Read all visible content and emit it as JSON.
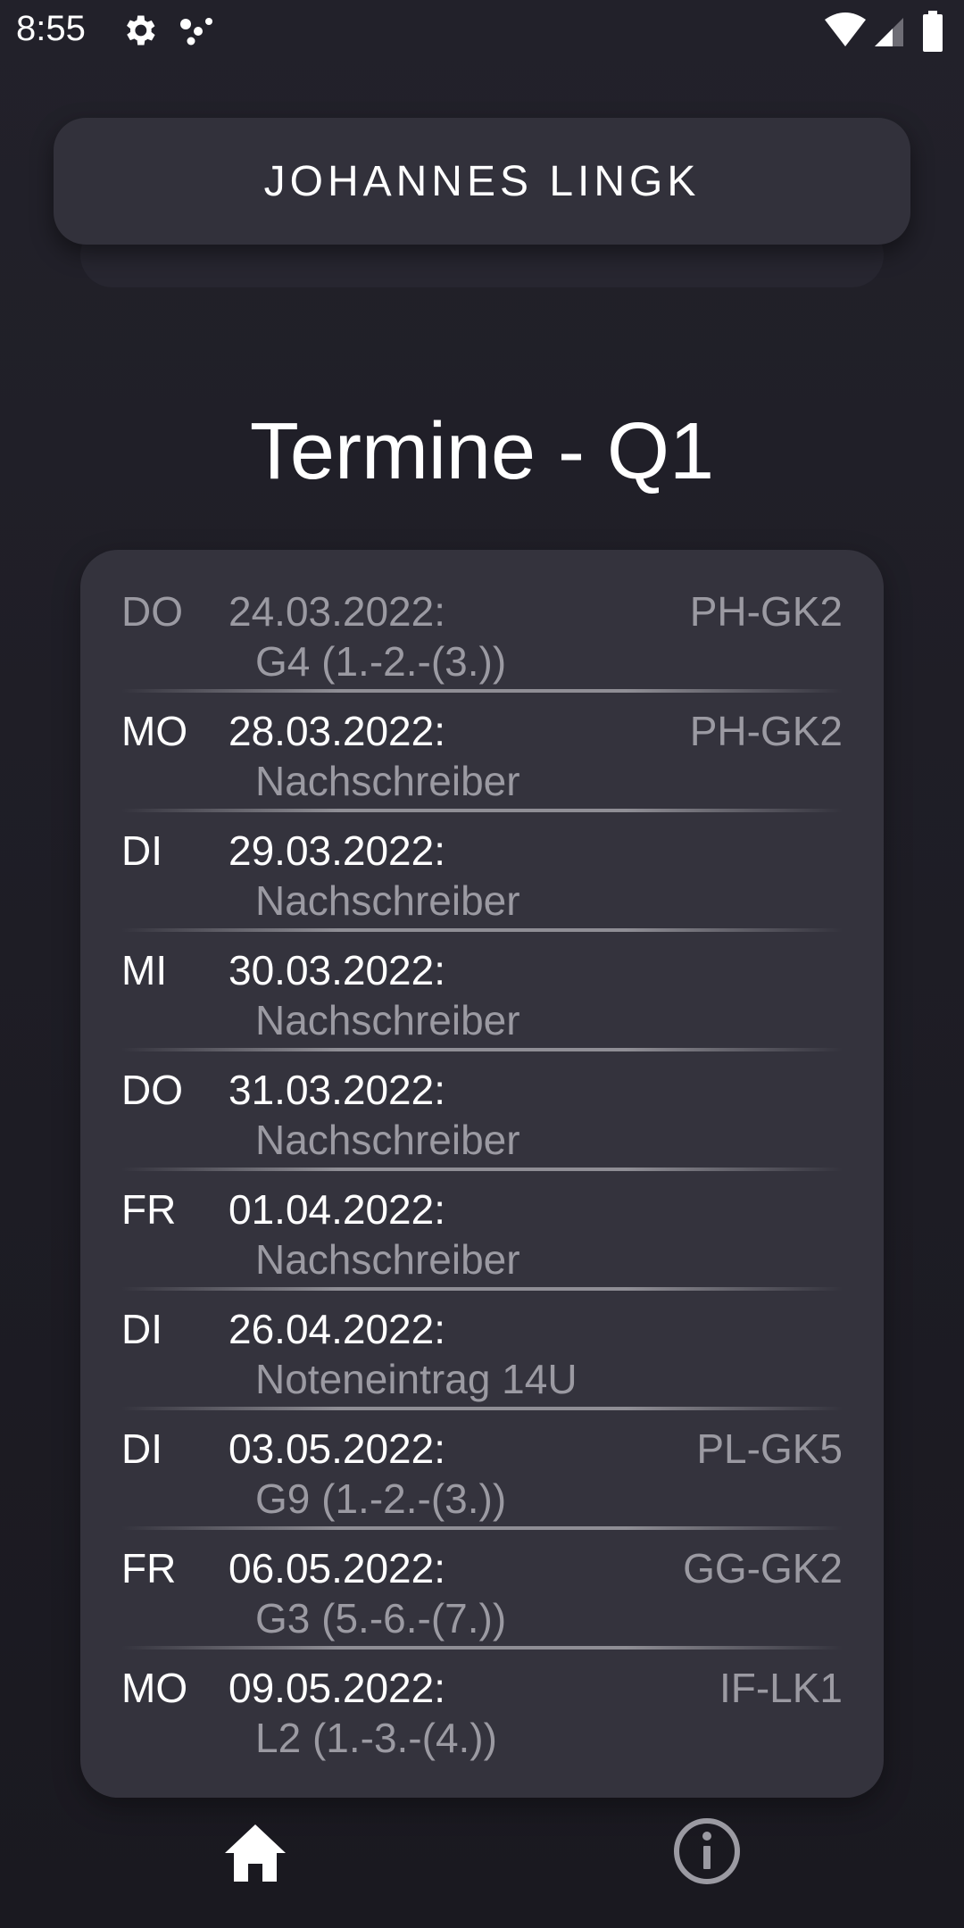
{
  "status_bar": {
    "time": "8:55",
    "icons": [
      "settings-gear-icon",
      "assistant-dots-icon",
      "wifi-icon",
      "cell-signal-icon",
      "battery-icon"
    ]
  },
  "header": {
    "name": "JOHANNES LINGK"
  },
  "page": {
    "title": "Termine - Q1"
  },
  "entries": [
    {
      "day": "DO",
      "date": "24.03.2022:",
      "course": "PH-GK2",
      "desc": "G4 (1.-2.-(3.))"
    },
    {
      "day": "MO",
      "date": "28.03.2022:",
      "course": "PH-GK2",
      "desc": "Nachschreiber"
    },
    {
      "day": "DI",
      "date": "29.03.2022:",
      "course": "",
      "desc": "Nachschreiber"
    },
    {
      "day": "MI",
      "date": "30.03.2022:",
      "course": "",
      "desc": "Nachschreiber"
    },
    {
      "day": "DO",
      "date": "31.03.2022:",
      "course": "",
      "desc": "Nachschreiber"
    },
    {
      "day": "FR",
      "date": "01.04.2022:",
      "course": "",
      "desc": "Nachschreiber"
    },
    {
      "day": "DI",
      "date": "26.04.2022:",
      "course": "",
      "desc": "Noteneintrag 14U"
    },
    {
      "day": "DI",
      "date": "03.05.2022:",
      "course": "PL-GK5",
      "desc": "G9 (1.-2.-(3.))"
    },
    {
      "day": "FR",
      "date": "06.05.2022:",
      "course": "GG-GK2",
      "desc": "G3 (5.-6.-(7.))"
    },
    {
      "day": "MO",
      "date": "09.05.2022:",
      "course": "IF-LK1",
      "desc": "L2 (1.-3.-(4.))"
    }
  ],
  "bottom_nav": {
    "items": [
      {
        "icon": "home-icon"
      },
      {
        "icon": "info-icon"
      }
    ]
  },
  "colors": {
    "background": "#1d1c24",
    "card": "#34333d",
    "header_card": "#32313b",
    "text_primary": "#ffffff",
    "text_secondary": "#9b9aa2"
  }
}
